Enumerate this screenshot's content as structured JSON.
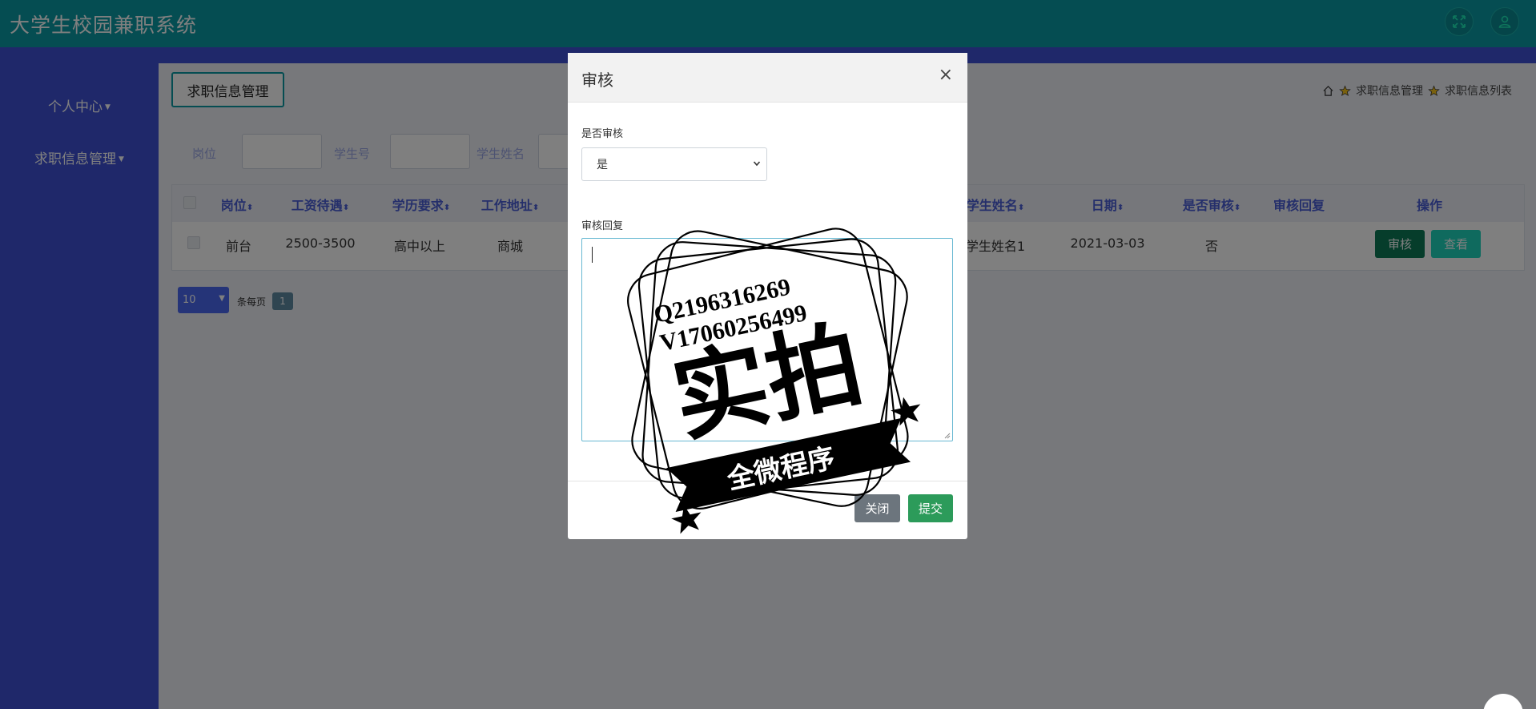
{
  "app": {
    "title": "大学生校园兼职系统"
  },
  "header": {
    "icons": [
      "fullscreen-icon",
      "user-icon"
    ]
  },
  "sidebar": {
    "items": [
      {
        "label": "个人中心"
      },
      {
        "label": "求职信息管理"
      }
    ]
  },
  "main": {
    "tab_label": "求职信息管理",
    "breadcrumb": [
      "求职信息管理",
      "求职信息列表"
    ],
    "search": {
      "labels": [
        "岗位",
        "学生号",
        "学生姓名"
      ]
    },
    "table": {
      "headers": [
        "岗位",
        "工资待遇",
        "学历要求",
        "工作地址",
        "学生姓名",
        "日期",
        "是否审核",
        "审核回复",
        "操作"
      ],
      "rows": [
        {
          "position": "前台",
          "salary": "2500-3500",
          "education": "高中以上",
          "address": "商城",
          "student_name": "学生姓名1",
          "date": "2021-03-03",
          "reviewed": "否",
          "reply": ""
        }
      ],
      "actions": {
        "review": "审核",
        "view": "查看"
      }
    },
    "pagination": {
      "page_size": "10",
      "page_size_label": "条每页",
      "current_page": "1"
    }
  },
  "modal": {
    "title": "审核",
    "close_symbol": "×",
    "review_label": "是否审核",
    "review_value": "是",
    "reply_label": "审核回复",
    "reply_value": "",
    "close_button": "关闭",
    "submit_button": "提交"
  },
  "watermark": {
    "line1": "Q2196316269",
    "line2": "V17060256499",
    "big": "实拍",
    "banner": "全微程序"
  },
  "colors": {
    "header": "#0b9aa4",
    "sidebar": "#3f51d5",
    "review_button": "#0c7a56",
    "view_button": "#1fd4bd",
    "submit_button": "#2c9b5a"
  }
}
